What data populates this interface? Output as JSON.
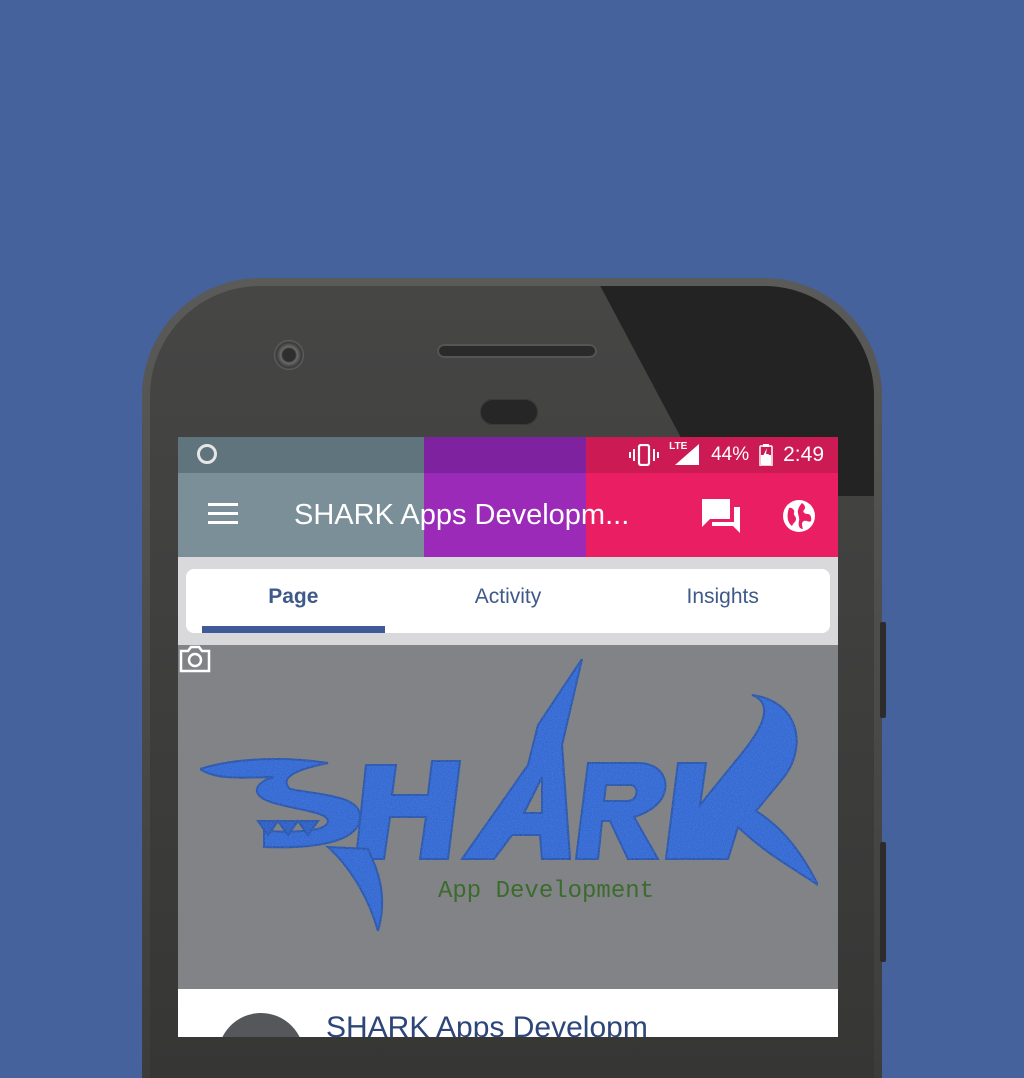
{
  "status_bar": {
    "network": "LTE",
    "battery": "44%",
    "time": "2:49"
  },
  "app_bar": {
    "title": "SHARK Apps Developm..."
  },
  "tabs": [
    {
      "label": "Page",
      "active": true
    },
    {
      "label": "Activity",
      "active": false
    },
    {
      "label": "Insights",
      "active": false
    }
  ],
  "cover": {
    "logo_text": "SHARK",
    "logo_subtitle": "App Development"
  },
  "page_name_partial": "SHARK Apps Developm",
  "colors": {
    "background": "#45629d",
    "statusbar_gray": "#5f747c",
    "statusbar_purple": "#7f22a0",
    "statusbar_pink": "#cc1a55",
    "appbar_pink": "#ea1f63",
    "tab_indicator": "#3f5a96",
    "logo_blue": "#2a5cc8"
  },
  "icons": [
    "menu-icon",
    "chat-icon",
    "globe-icon",
    "camera-icon",
    "vibrate-icon",
    "signal-icon",
    "battery-icon"
  ]
}
